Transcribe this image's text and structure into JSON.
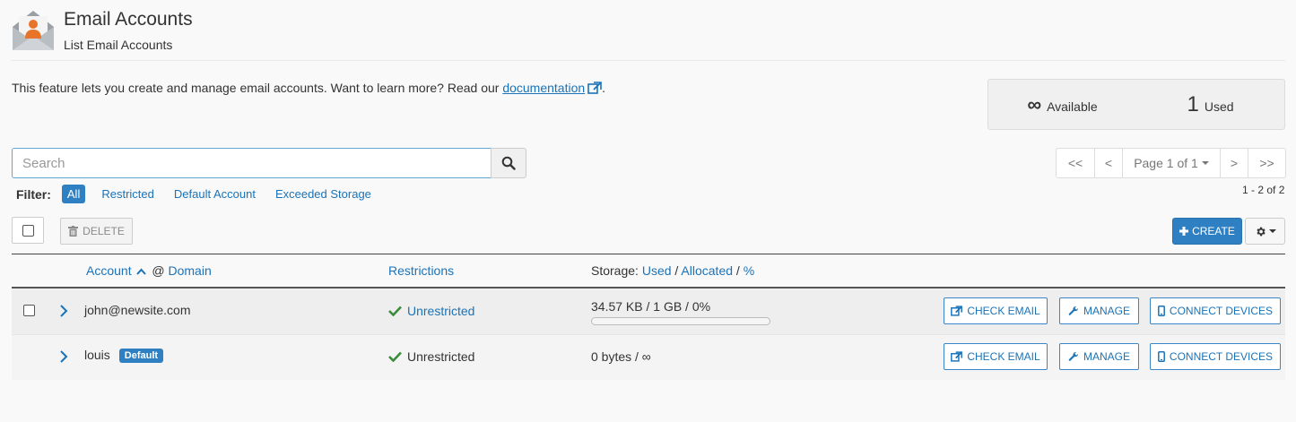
{
  "header": {
    "title": "Email Accounts",
    "subtitle": "List Email Accounts"
  },
  "intro": {
    "text": "This feature lets you create and manage email accounts. Want to learn more? Read our ",
    "link": "documentation",
    "suffix": "."
  },
  "stats": {
    "available_value": "∞",
    "available_label": "Available",
    "used_value": "1",
    "used_label": "Used"
  },
  "search": {
    "placeholder": "Search",
    "value": ""
  },
  "filter": {
    "label": "Filter:",
    "items": [
      "All",
      "Restricted",
      "Default Account",
      "Exceeded Storage"
    ],
    "active": "All"
  },
  "pagination": {
    "first": "<<",
    "prev": "<",
    "page_label": "Page 1 of 1",
    "next": ">",
    "last": ">>",
    "range": "1 - 2 of 2"
  },
  "toolbar": {
    "delete_label": "DELETE",
    "create_label": "CREATE"
  },
  "table": {
    "col_account": "Account",
    "col_at": "@",
    "col_domain": "Domain",
    "col_restrictions": "Restrictions",
    "storage_prefix": "Storage:",
    "storage_used": "Used",
    "storage_sep1": "/",
    "storage_allocated": "Allocated",
    "storage_sep2": "/",
    "storage_percent": "%",
    "rows": [
      {
        "account": "john@newsite.com",
        "badge": "",
        "restriction": "Unrestricted",
        "storage": "34.57 KB / 1 GB / 0%",
        "usage_percent": 0,
        "check_email": "CHECK EMAIL",
        "manage": "MANAGE",
        "connect": "CONNECT DEVICES"
      },
      {
        "account": "louis",
        "badge": "Default",
        "restriction": "Unrestricted",
        "storage": "0 bytes / ∞",
        "check_email": "CHECK EMAIL",
        "manage": "MANAGE",
        "connect": "CONNECT DEVICES"
      }
    ]
  },
  "colors": {
    "accent": "#2f80c3",
    "link": "#1a73b8",
    "success": "#3c8b3c",
    "icon_orange": "#e8742a"
  }
}
